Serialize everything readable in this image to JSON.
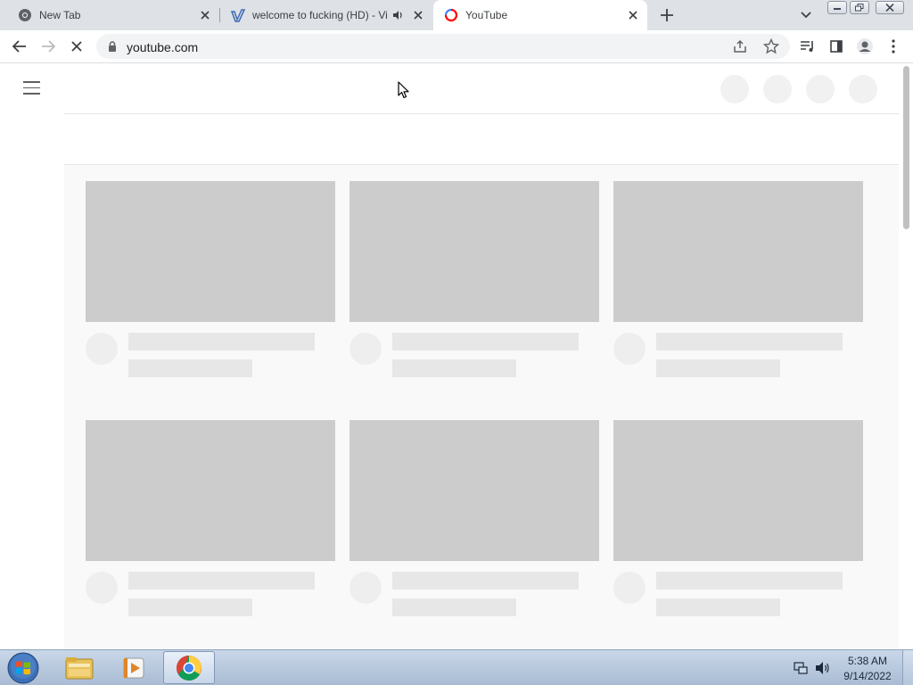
{
  "tabs": [
    {
      "title": "New Tab",
      "favicon": "chrome-icon"
    },
    {
      "title": "welcome to fucking (HD) - Vi",
      "favicon": "vimeo-icon",
      "audio": "speaker-icon"
    },
    {
      "title": "YouTube",
      "favicon": "youtube-loading-icon",
      "active": true
    }
  ],
  "toolbar": {
    "url": "youtube.com",
    "loading": true
  },
  "page": {
    "state": "loading skeleton",
    "card_rows": 2,
    "cards_per_row": 3
  },
  "taskbar": {
    "items": [
      "windows-explorer-icon",
      "media-player-icon",
      "chrome-icon"
    ],
    "time": "5:38 AM",
    "date": "9/14/2022"
  },
  "colors": {
    "tabstrip": "#dee1e6",
    "skeleton_thumb": "#cccccc",
    "skeleton_line": "#e7e7e7",
    "youtube_red": "#ff0000"
  }
}
